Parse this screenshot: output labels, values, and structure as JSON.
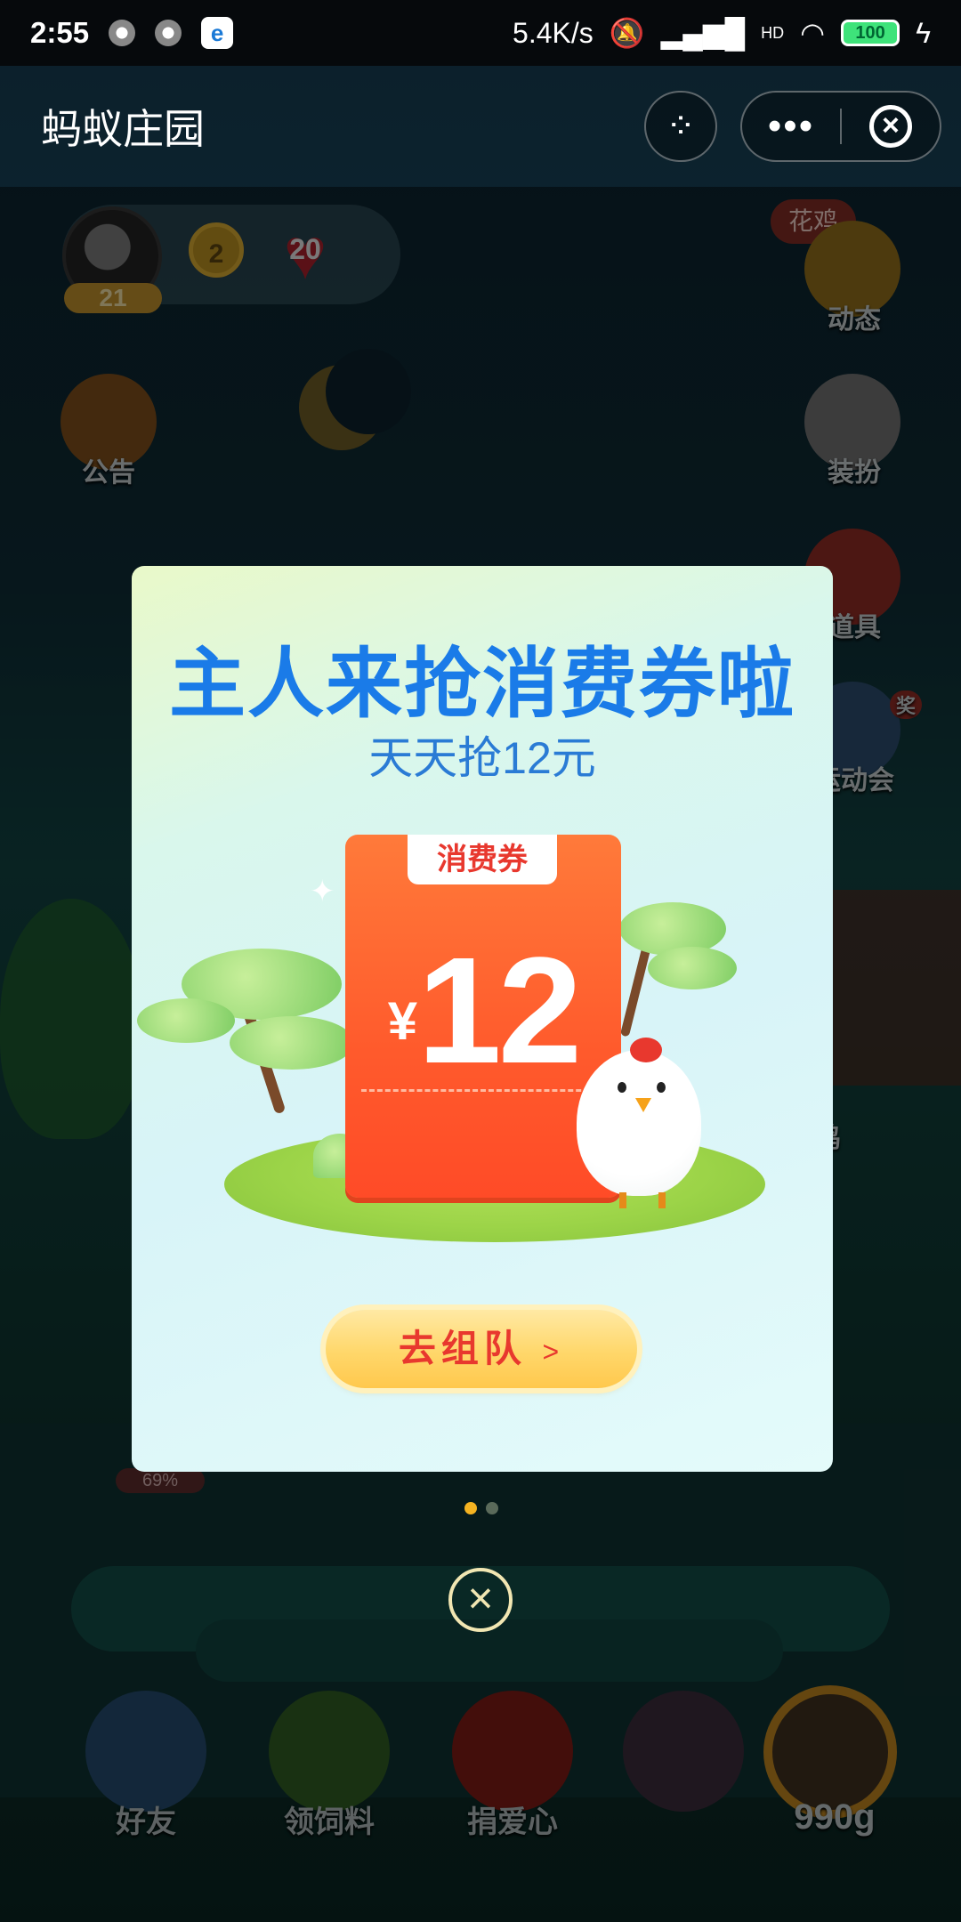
{
  "status_bar": {
    "time": "2:55",
    "speed": "5.4K/s",
    "network_label": "HD",
    "battery": "100"
  },
  "top_bar": {
    "title": "蚂蚁庄园",
    "more": "•••",
    "close": "×"
  },
  "profile": {
    "level": "21",
    "medal_rank": "2",
    "love_count": "20"
  },
  "side_menu": {
    "left": [
      {
        "label": "公告"
      }
    ],
    "right": [
      {
        "label": "动态",
        "tag": "花鸡"
      },
      {
        "label": "装扮"
      },
      {
        "label": "道具"
      },
      {
        "label": "运动会",
        "badge": "奖"
      }
    ]
  },
  "background": {
    "progress_pct": "69%",
    "chicken_label_partial": "鸡"
  },
  "bottom_bar": {
    "items": [
      {
        "label": "好友"
      },
      {
        "label": "领饲料"
      },
      {
        "label": "捐爱心"
      }
    ],
    "food_amount": "990g"
  },
  "modal": {
    "title": "主人来抢消费券啦",
    "subtitle": "天天抢12元",
    "coupon": {
      "tab_label": "消费券",
      "currency": "¥",
      "amount": "12"
    },
    "cta_label": "去组队",
    "cta_arrow": ">",
    "close": "×",
    "pagination": {
      "current": 1,
      "total": 2
    }
  },
  "colors": {
    "modal_title": "#1a7be8",
    "coupon": "#ff5a2c",
    "cta_text": "#e8382e",
    "active_dot": "#f5b321"
  }
}
